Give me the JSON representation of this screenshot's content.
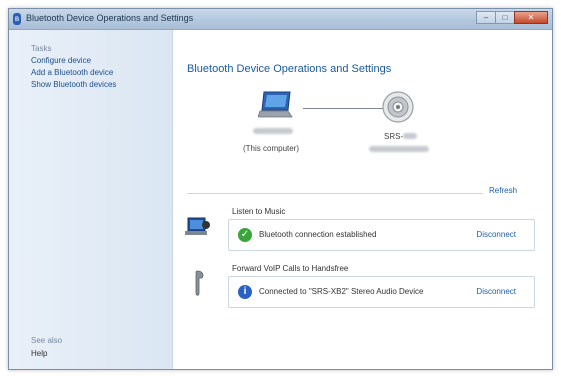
{
  "window": {
    "title": "Bluetooth Device Operations and Settings"
  },
  "sidebar": {
    "tasks_heading": "Tasks",
    "links": [
      {
        "label": "Configure device"
      },
      {
        "label": "Add a Bluetooth device"
      },
      {
        "label": "Show Bluetooth devices"
      }
    ],
    "see_also_heading": "See also",
    "help_label": "Help"
  },
  "main": {
    "title": "Bluetooth Device Operations and Settings",
    "computer_caption": "(This computer)",
    "device_name_prefix": "SRS-",
    "refresh_label": "Refresh",
    "services": [
      {
        "title": "Listen to Music",
        "status": "Bluetooth connection established",
        "status_type": "success",
        "action": "Disconnect"
      },
      {
        "title": "Forward VoIP Calls to Handsfree",
        "status": "Connected to \"SRS-XB2\" Stereo Audio Device",
        "status_type": "info",
        "action": "Disconnect"
      }
    ]
  },
  "colors": {
    "link": "#1d5fa8",
    "success": "#3aa53a",
    "info": "#2a62c4"
  }
}
